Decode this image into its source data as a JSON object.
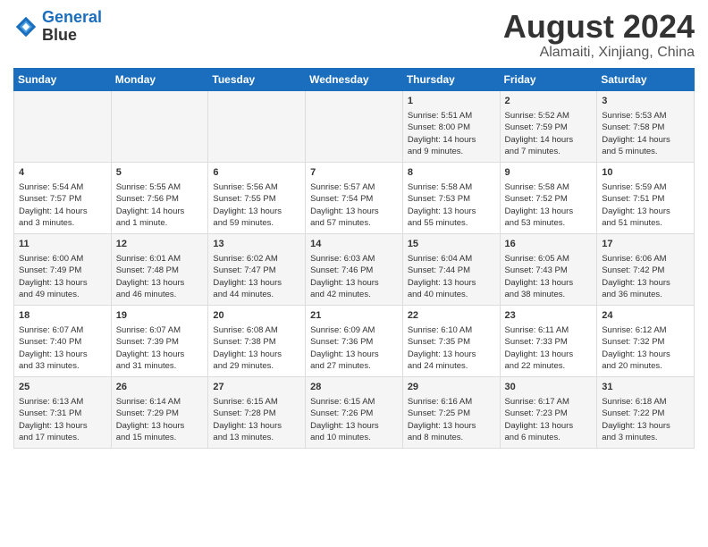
{
  "header": {
    "logo_line1": "General",
    "logo_line2": "Blue",
    "month_title": "August 2024",
    "subtitle": "Alamaiti, Xinjiang, China"
  },
  "weekdays": [
    "Sunday",
    "Monday",
    "Tuesday",
    "Wednesday",
    "Thursday",
    "Friday",
    "Saturday"
  ],
  "weeks": [
    [
      {
        "day": "",
        "text": ""
      },
      {
        "day": "",
        "text": ""
      },
      {
        "day": "",
        "text": ""
      },
      {
        "day": "",
        "text": ""
      },
      {
        "day": "1",
        "text": "Sunrise: 5:51 AM\nSunset: 8:00 PM\nDaylight: 14 hours\nand 9 minutes."
      },
      {
        "day": "2",
        "text": "Sunrise: 5:52 AM\nSunset: 7:59 PM\nDaylight: 14 hours\nand 7 minutes."
      },
      {
        "day": "3",
        "text": "Sunrise: 5:53 AM\nSunset: 7:58 PM\nDaylight: 14 hours\nand 5 minutes."
      }
    ],
    [
      {
        "day": "4",
        "text": "Sunrise: 5:54 AM\nSunset: 7:57 PM\nDaylight: 14 hours\nand 3 minutes."
      },
      {
        "day": "5",
        "text": "Sunrise: 5:55 AM\nSunset: 7:56 PM\nDaylight: 14 hours\nand 1 minute."
      },
      {
        "day": "6",
        "text": "Sunrise: 5:56 AM\nSunset: 7:55 PM\nDaylight: 13 hours\nand 59 minutes."
      },
      {
        "day": "7",
        "text": "Sunrise: 5:57 AM\nSunset: 7:54 PM\nDaylight: 13 hours\nand 57 minutes."
      },
      {
        "day": "8",
        "text": "Sunrise: 5:58 AM\nSunset: 7:53 PM\nDaylight: 13 hours\nand 55 minutes."
      },
      {
        "day": "9",
        "text": "Sunrise: 5:58 AM\nSunset: 7:52 PM\nDaylight: 13 hours\nand 53 minutes."
      },
      {
        "day": "10",
        "text": "Sunrise: 5:59 AM\nSunset: 7:51 PM\nDaylight: 13 hours\nand 51 minutes."
      }
    ],
    [
      {
        "day": "11",
        "text": "Sunrise: 6:00 AM\nSunset: 7:49 PM\nDaylight: 13 hours\nand 49 minutes."
      },
      {
        "day": "12",
        "text": "Sunrise: 6:01 AM\nSunset: 7:48 PM\nDaylight: 13 hours\nand 46 minutes."
      },
      {
        "day": "13",
        "text": "Sunrise: 6:02 AM\nSunset: 7:47 PM\nDaylight: 13 hours\nand 44 minutes."
      },
      {
        "day": "14",
        "text": "Sunrise: 6:03 AM\nSunset: 7:46 PM\nDaylight: 13 hours\nand 42 minutes."
      },
      {
        "day": "15",
        "text": "Sunrise: 6:04 AM\nSunset: 7:44 PM\nDaylight: 13 hours\nand 40 minutes."
      },
      {
        "day": "16",
        "text": "Sunrise: 6:05 AM\nSunset: 7:43 PM\nDaylight: 13 hours\nand 38 minutes."
      },
      {
        "day": "17",
        "text": "Sunrise: 6:06 AM\nSunset: 7:42 PM\nDaylight: 13 hours\nand 36 minutes."
      }
    ],
    [
      {
        "day": "18",
        "text": "Sunrise: 6:07 AM\nSunset: 7:40 PM\nDaylight: 13 hours\nand 33 minutes."
      },
      {
        "day": "19",
        "text": "Sunrise: 6:07 AM\nSunset: 7:39 PM\nDaylight: 13 hours\nand 31 minutes."
      },
      {
        "day": "20",
        "text": "Sunrise: 6:08 AM\nSunset: 7:38 PM\nDaylight: 13 hours\nand 29 minutes."
      },
      {
        "day": "21",
        "text": "Sunrise: 6:09 AM\nSunset: 7:36 PM\nDaylight: 13 hours\nand 27 minutes."
      },
      {
        "day": "22",
        "text": "Sunrise: 6:10 AM\nSunset: 7:35 PM\nDaylight: 13 hours\nand 24 minutes."
      },
      {
        "day": "23",
        "text": "Sunrise: 6:11 AM\nSunset: 7:33 PM\nDaylight: 13 hours\nand 22 minutes."
      },
      {
        "day": "24",
        "text": "Sunrise: 6:12 AM\nSunset: 7:32 PM\nDaylight: 13 hours\nand 20 minutes."
      }
    ],
    [
      {
        "day": "25",
        "text": "Sunrise: 6:13 AM\nSunset: 7:31 PM\nDaylight: 13 hours\nand 17 minutes."
      },
      {
        "day": "26",
        "text": "Sunrise: 6:14 AM\nSunset: 7:29 PM\nDaylight: 13 hours\nand 15 minutes."
      },
      {
        "day": "27",
        "text": "Sunrise: 6:15 AM\nSunset: 7:28 PM\nDaylight: 13 hours\nand 13 minutes."
      },
      {
        "day": "28",
        "text": "Sunrise: 6:15 AM\nSunset: 7:26 PM\nDaylight: 13 hours\nand 10 minutes."
      },
      {
        "day": "29",
        "text": "Sunrise: 6:16 AM\nSunset: 7:25 PM\nDaylight: 13 hours\nand 8 minutes."
      },
      {
        "day": "30",
        "text": "Sunrise: 6:17 AM\nSunset: 7:23 PM\nDaylight: 13 hours\nand 6 minutes."
      },
      {
        "day": "31",
        "text": "Sunrise: 6:18 AM\nSunset: 7:22 PM\nDaylight: 13 hours\nand 3 minutes."
      }
    ]
  ]
}
